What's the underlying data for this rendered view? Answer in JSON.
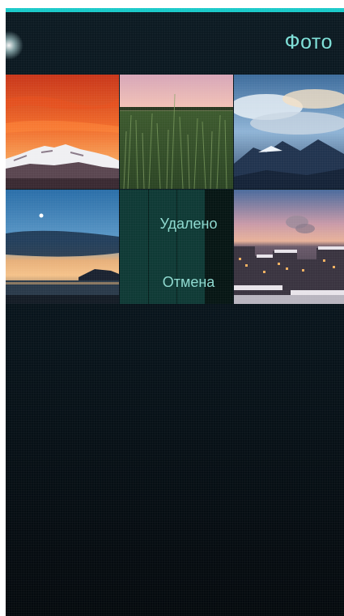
{
  "header": {
    "title": "Фото"
  },
  "deleted_item": {
    "status_label": "Удалено",
    "undo_label": "Отмена"
  },
  "photos": [
    {
      "name": "mountain-sunset"
    },
    {
      "name": "grass-field"
    },
    {
      "name": "cloudy-mountains"
    },
    {
      "name": "sea-twilight"
    },
    {
      "name": "deleted-photo"
    },
    {
      "name": "city-dusk"
    }
  ],
  "colors": {
    "accent_bar": "#19c9c9",
    "header_text": "#7ee0d8",
    "deleted_tile": "#0f3a35",
    "deleted_text": "#8ed9cf"
  }
}
